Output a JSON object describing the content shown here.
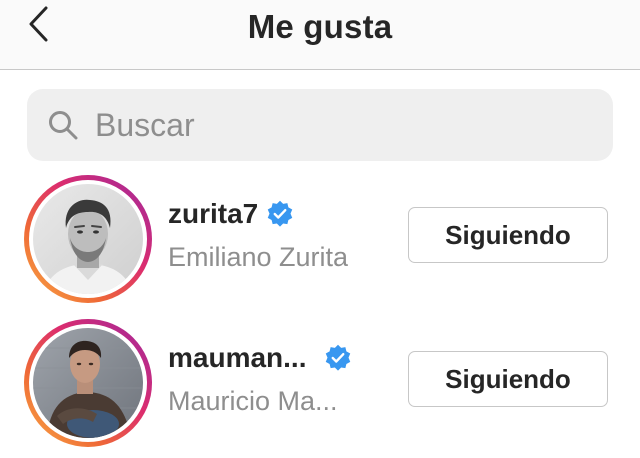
{
  "header": {
    "title": "Me gusta",
    "back_icon": "chevron-left-icon"
  },
  "search": {
    "placeholder": "Buscar",
    "value": "",
    "icon": "search-icon"
  },
  "users": [
    {
      "username": "zurita7",
      "full_name": "Emiliano Zurita",
      "verified": true,
      "button_label": "Siguiendo"
    },
    {
      "username": "mauman...",
      "full_name": "Mauricio Ma...",
      "verified": true,
      "button_label": "Siguiendo"
    }
  ],
  "colors": {
    "verified": "#3897f0",
    "text_primary": "#262626",
    "text_secondary": "#8e8e8e",
    "search_bg": "#efefef",
    "story_ring_start": "#f9ae46",
    "story_ring_end": "#9d2bb3"
  }
}
